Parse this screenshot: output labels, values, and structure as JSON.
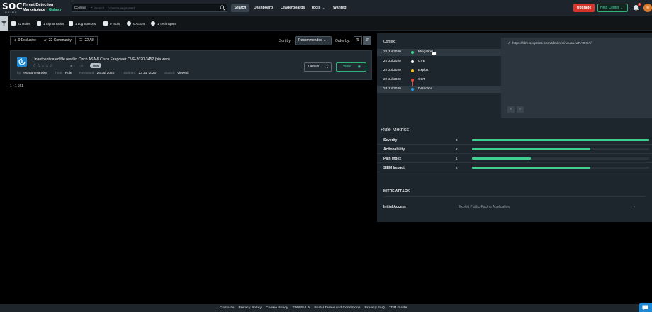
{
  "header": {
    "logo_text": "SOC",
    "logo_subtext": "PRIME",
    "brand_line1": "Threat Detection",
    "brand_line2": "Marketplace",
    "brand_accent": "· Galaxy",
    "search": {
      "type_label": "Content",
      "placeholder": "Search... (comma separated)"
    },
    "search_button": "Search",
    "nav": [
      "Dashboard",
      "Leaderboards",
      "Tools",
      "Wanted"
    ],
    "upgrade_button": "Upgrade",
    "help_button": "Help Center",
    "notification_count": "1",
    "avatar_initials": "RT",
    "colors": {
      "bar": "#1d242b",
      "accent": "#43d39e",
      "danger": "#d6332d"
    }
  },
  "stats": [
    {
      "icon": "rules-icon",
      "label": "22 Rules"
    },
    {
      "icon": "sigma-icon",
      "label": "1 Sigma Rules"
    },
    {
      "icon": "log-sources-icon",
      "label": "1 Log Sources"
    },
    {
      "icon": "tools-icon",
      "label": "0 Tools"
    },
    {
      "icon": "actors-icon",
      "label": "0 Actors"
    },
    {
      "icon": "techniques-icon",
      "label": "1 Techniques"
    }
  ],
  "tabs": [
    {
      "label": "0 Exclusive",
      "icon": "diamond-icon"
    },
    {
      "label": "22 Community",
      "icon": "community-icon"
    },
    {
      "label": "22 All",
      "icon": "all-icon"
    }
  ],
  "sort": {
    "label": "Sort by:",
    "value": "Recommended"
  },
  "order": {
    "label": "Order by:"
  },
  "rule": {
    "title": "Unauthenticated file read in Cisco ASA & Cisco Firepower CVE-2020-3452 (via web)",
    "stars": "☆☆☆☆☆",
    "views": "1",
    "downloads": "0",
    "badge": "New",
    "author_label": "by:",
    "author": "Roman Ranskyi",
    "type_label": "Type:",
    "type": "Rule",
    "released_label": "Released:",
    "released": "23 Jul 2020",
    "updated_label": "Updated:",
    "updated": "23 Jul 2020",
    "status_label": "Status:",
    "status": "Viewed",
    "details_button": "Details",
    "view_button": "View"
  },
  "pager": "1 - 1 of 1",
  "context": {
    "title": "Context",
    "url": "https://tdm.socprime.com/tdm/info/A4uas.iwRAGGA/",
    "items": [
      {
        "date": "22 Jul 2020",
        "label": "Mitigation",
        "color": "#3fcf8e",
        "highlight": true
      },
      {
        "date": "22 Jul 2020",
        "label": "CVE",
        "color": "#ffffff",
        "highlight": false
      },
      {
        "date": "22 Jul 2020",
        "label": "Exploit",
        "color": "#f2c018",
        "highlight": false
      },
      {
        "date": "22 Jul 2020",
        "label": "OST",
        "color": "#e44a3f",
        "highlight": false
      },
      {
        "date": "23 Jul 2020",
        "label": "Detection",
        "color": "#2fa4e7",
        "highlight": true
      }
    ]
  },
  "rule_metrics": {
    "title": "Rule Metrics",
    "max": 3,
    "items": [
      {
        "label": "Severity",
        "value": 3
      },
      {
        "label": "Actionability",
        "value": 2
      },
      {
        "label": "Pain Index",
        "value": 1
      },
      {
        "label": "SIEM Impact",
        "value": 2
      }
    ]
  },
  "mitre": {
    "title": "MITRE ATT&CK",
    "tactic": "Initial Access",
    "technique": "Exploit Public-Facing Application"
  },
  "footer": {
    "links": [
      "Contacts",
      "Privacy Policy",
      "Cookie Policy",
      "TDM EULA",
      "Portal Terms and Conditions",
      "Privacy FAQ",
      "TDM Guide"
    ]
  }
}
